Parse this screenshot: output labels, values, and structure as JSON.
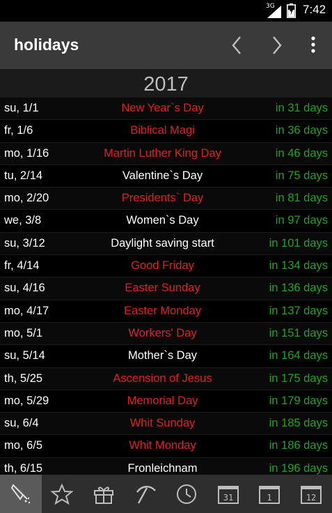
{
  "status": {
    "network": "3G",
    "time": "7:42"
  },
  "app": {
    "title": "holidays"
  },
  "year": "2017",
  "colors": {
    "official_holiday": "#e02020",
    "regular_day": "#ffffff",
    "countdown": "#1fa31f",
    "app_bar": "#3a3a3a"
  },
  "holidays": [
    {
      "date": "su, 1/1",
      "name": "New Year`s Day",
      "until": "in 31 days",
      "official": true
    },
    {
      "date": "fr, 1/6",
      "name": "Biblical Magi",
      "until": "in 36 days",
      "official": true
    },
    {
      "date": "mo, 1/16",
      "name": "Martin Luther King Day",
      "until": "in 46 days",
      "official": true
    },
    {
      "date": "tu, 2/14",
      "name": "Valentine`s Day",
      "until": "in 75 days",
      "official": false
    },
    {
      "date": "mo, 2/20",
      "name": "Presidents` Day",
      "until": "in 81 days",
      "official": true
    },
    {
      "date": "we, 3/8",
      "name": "Women`s Day",
      "until": "in 97 days",
      "official": false
    },
    {
      "date": "su, 3/12",
      "name": "Daylight saving start",
      "until": "in 101 days",
      "official": false
    },
    {
      "date": "fr, 4/14",
      "name": "Good Friday",
      "until": "in 134 days",
      "official": true
    },
    {
      "date": "su, 4/16",
      "name": "Easter Sunday",
      "until": "in 136 days",
      "official": true
    },
    {
      "date": "mo, 4/17",
      "name": "Easter Monday",
      "until": "in 137 days",
      "official": true
    },
    {
      "date": "mo, 5/1",
      "name": "Workers' Day",
      "until": "in 151 days",
      "official": true
    },
    {
      "date": "su, 5/14",
      "name": "Mother`s Day",
      "until": "in 164 days",
      "official": false
    },
    {
      "date": "th, 5/25",
      "name": "Ascension of Jesus",
      "until": "in 175 days",
      "official": true
    },
    {
      "date": "mo, 5/29",
      "name": "Memorial Day",
      "until": "in 179 days",
      "official": true
    },
    {
      "date": "su, 6/4",
      "name": "Whit Sunday",
      "until": "in 185 days",
      "official": true
    },
    {
      "date": "mo, 6/5",
      "name": "Whit Monday",
      "until": "in 186 days",
      "official": true
    },
    {
      "date": "th, 6/15",
      "name": "Fronleichnam",
      "until": "in 196 days",
      "official": false
    }
  ],
  "bottom_tabs": [
    {
      "icon": "holidays-icon",
      "active": true
    },
    {
      "icon": "star-icon",
      "active": false
    },
    {
      "icon": "gift-icon",
      "active": false
    },
    {
      "icon": "pickaxe-icon",
      "active": false
    },
    {
      "icon": "clock-icon",
      "active": false
    },
    {
      "icon": "calendar-month-icon",
      "label": "31",
      "active": false
    },
    {
      "icon": "calendar-day-icon",
      "label": "1",
      "active": false
    },
    {
      "icon": "calendar-year-icon",
      "label": "12",
      "active": false
    }
  ]
}
